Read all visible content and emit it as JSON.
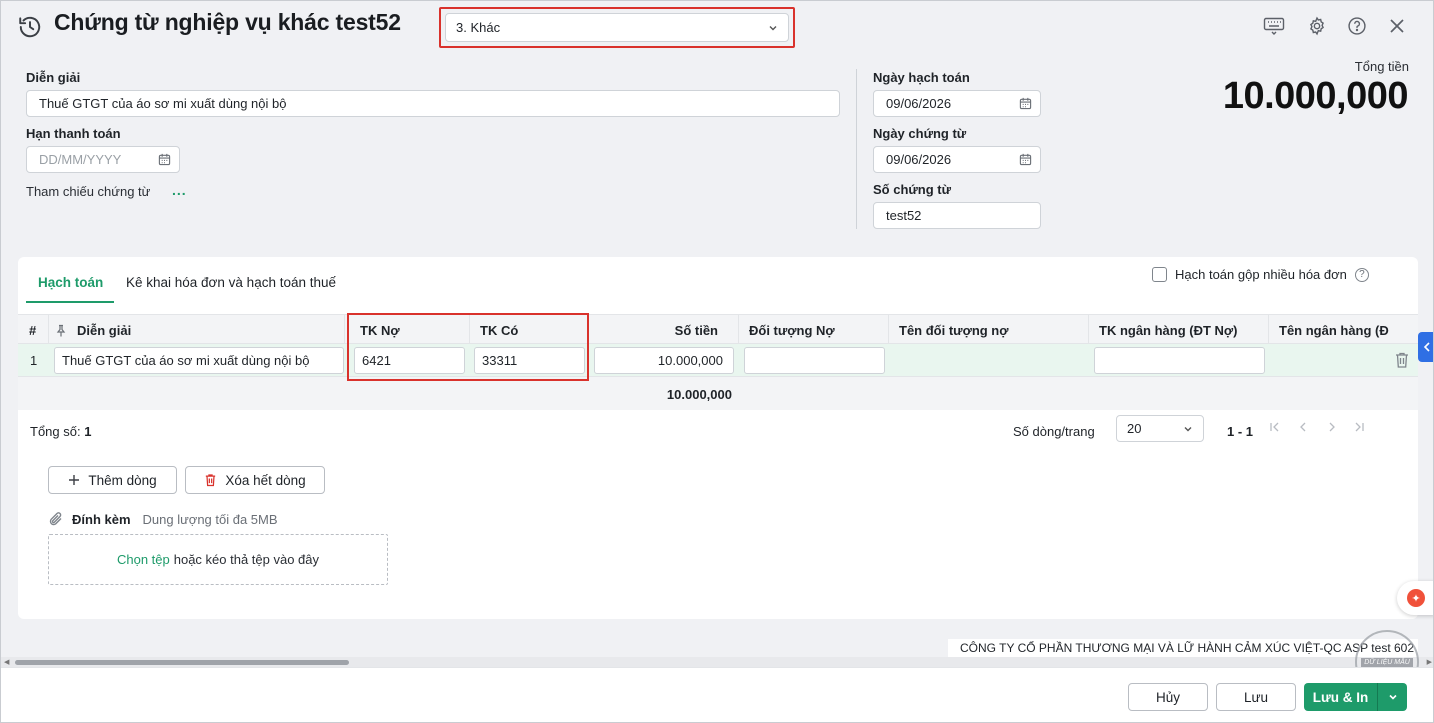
{
  "header": {
    "title": "Chứng từ nghiệp vụ khác test52",
    "type_select": "3. Khác"
  },
  "form": {
    "dien_giai_label": "Diễn giải",
    "dien_giai_value": "Thuế GTGT của áo sơ mi xuất dùng nội bộ",
    "han_tt_label": "Hạn thanh toán",
    "han_tt_placeholder": "DD/MM/YYYY",
    "tham_chieu_label": "Tham chiếu chứng từ",
    "tham_chieu_more": "...",
    "ngay_hach_toan_label": "Ngày hạch toán",
    "ngay_hach_toan_value": "09/06/2026",
    "ngay_chung_tu_label": "Ngày chứng từ",
    "ngay_chung_tu_value": "09/06/2026",
    "so_chung_tu_label": "Số chứng từ",
    "so_chung_tu_value": "test52",
    "tong_tien_label": "Tổng tiền",
    "tong_tien_value": "10.000,000"
  },
  "tabs": [
    {
      "label": "Hạch toán",
      "active": true
    },
    {
      "label": "Kê khai hóa đơn và hạch toán thuế",
      "active": false
    }
  ],
  "merge_checkbox_label": "Hạch toán gộp nhiều hóa đơn",
  "table": {
    "columns": [
      "#",
      "Diễn giải",
      "TK Nợ",
      "TK Có",
      "Số tiền",
      "Đối tượng Nợ",
      "Tên đối tượng nợ",
      "TK ngân hàng (ĐT Nợ)",
      "Tên ngân hàng (Đ"
    ],
    "rows": [
      {
        "no": "1",
        "dien_giai": "Thuế GTGT của áo sơ mi xuất dùng nội bộ",
        "tk_no": "6421",
        "tk_co": "33311",
        "so_tien": "10.000,000",
        "doi_tuong_no": "",
        "ten_doi_tuong_no": "",
        "tk_ngan_hang": "",
        "ten_ngan_hang": ""
      }
    ],
    "sum_so_tien": "10.000,000"
  },
  "pager": {
    "total_label": "Tổng số:",
    "total_value": "1",
    "rows_per_page_label": "Số dòng/trang",
    "rows_per_page": "20",
    "range": "1 - 1"
  },
  "actions": {
    "add_row": "Thêm dòng",
    "delete_all": "Xóa hết dòng",
    "attach_label": "Đính kèm",
    "attach_hint": "Dung lượng tối đa 5MB",
    "choose_file": "Chọn tệp",
    "drop_hint": "hoặc kéo thả tệp vào đây"
  },
  "company": "CÔNG TY CỔ PHẦN THƯƠNG MẠI VÀ LỮ HÀNH CẢM XÚC VIỆT-QC ASP test 602",
  "watermark": "DỮ LIỆU MẪU",
  "footer": {
    "cancel": "Hủy",
    "save": "Lưu",
    "save_print": "Lưu & In"
  },
  "colors": {
    "accent": "#1e9b6a",
    "highlight_border": "#d9322c",
    "row_bg": "#e9f6ef"
  }
}
